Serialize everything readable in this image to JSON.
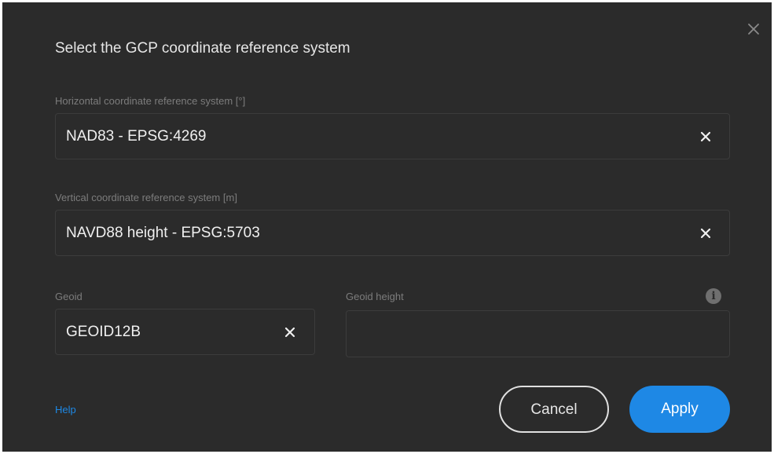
{
  "dialog": {
    "title": "Select the GCP coordinate reference system",
    "close_icon": "close-icon"
  },
  "horizontal_crs": {
    "label": "Horizontal coordinate reference system [°]",
    "value": "NAD83 - EPSG:4269",
    "clear_icon": "clear-icon"
  },
  "vertical_crs": {
    "label": "Vertical coordinate reference system [m]",
    "value": "NAVD88 height - EPSG:5703",
    "clear_icon": "clear-icon"
  },
  "geoid": {
    "label": "Geoid",
    "value": "GEOID12B",
    "clear_icon": "clear-icon"
  },
  "geoid_height": {
    "label": "Geoid height",
    "value": "",
    "info_icon": "info-icon",
    "info_glyph": "i"
  },
  "footer": {
    "help_label": "Help",
    "cancel_label": "Cancel",
    "apply_label": "Apply"
  },
  "colors": {
    "background": "#2b2b2b",
    "accent": "#1e88e5",
    "label": "#7c7c7c",
    "text": "#f0f0f0"
  }
}
